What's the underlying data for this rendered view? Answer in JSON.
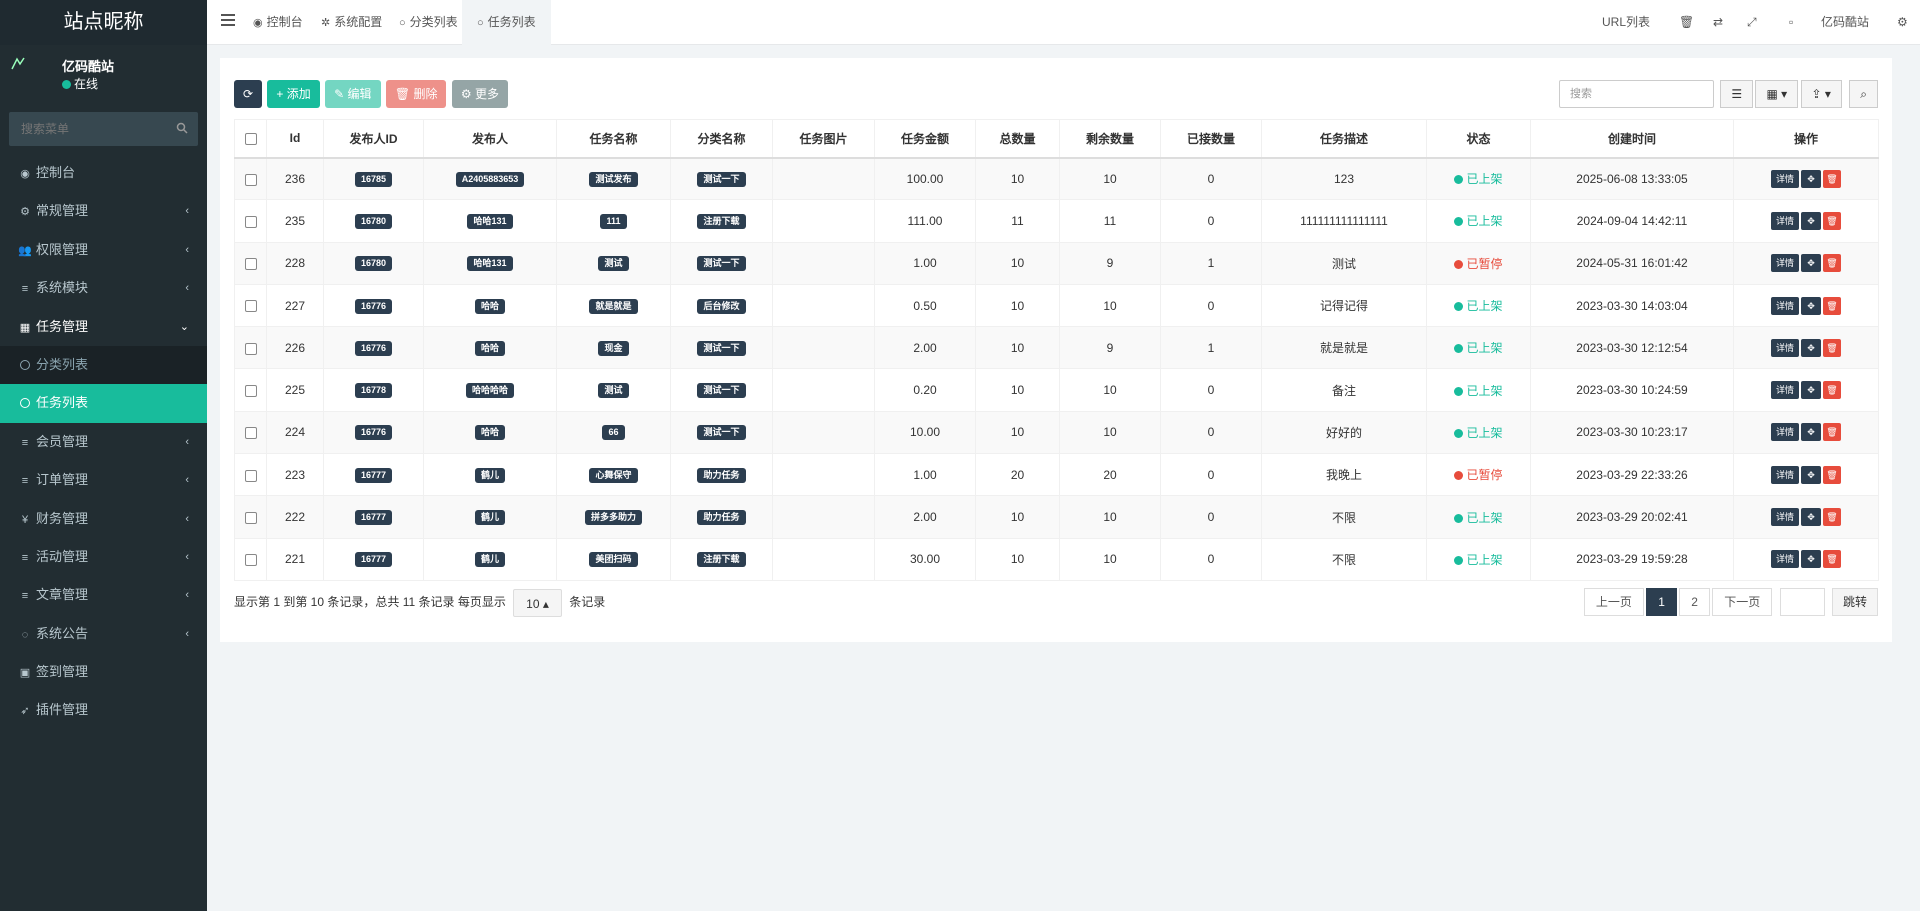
{
  "site_title": "站点昵称",
  "user": {
    "name": "亿码酷站",
    "status": "在线"
  },
  "sidebar": {
    "search_placeholder": "搜索菜单",
    "items": [
      {
        "icon": "dashboard-icon",
        "glyph": "◉",
        "label": "控制台",
        "has_arrow": false
      },
      {
        "icon": "cogs-icon",
        "glyph": "⚙",
        "label": "常规管理",
        "has_arrow": true
      },
      {
        "icon": "users-icon",
        "glyph": "👥",
        "label": "权限管理",
        "has_arrow": true
      },
      {
        "icon": "list-icon",
        "glyph": "≡",
        "label": "系统模块",
        "has_arrow": true
      },
      {
        "icon": "table-icon",
        "glyph": "▦",
        "label": "任务管理",
        "has_arrow": true,
        "open": true
      },
      {
        "icon": "circle-icon",
        "label": "分类列表",
        "sub": true
      },
      {
        "icon": "circle-icon",
        "label": "任务列表",
        "sub": true,
        "active": true
      },
      {
        "icon": "list-icon",
        "glyph": "≡",
        "label": "会员管理",
        "has_arrow": true
      },
      {
        "icon": "list-icon",
        "glyph": "≡",
        "label": "订单管理",
        "has_arrow": true
      },
      {
        "icon": "yen-icon",
        "glyph": "¥",
        "label": "财务管理",
        "has_arrow": true
      },
      {
        "icon": "list-icon",
        "glyph": "≡",
        "label": "活动管理",
        "has_arrow": true
      },
      {
        "icon": "list-icon",
        "glyph": "≡",
        "label": "文章管理",
        "has_arrow": true
      },
      {
        "icon": "comment-icon",
        "glyph": "◌",
        "label": "系统公告",
        "has_arrow": true
      },
      {
        "icon": "calendar-icon",
        "glyph": "▣",
        "label": "签到管理",
        "has_arrow": false
      },
      {
        "icon": "rocket-icon",
        "glyph": "➶",
        "label": "插件管理",
        "has_arrow": false
      }
    ]
  },
  "topnav": {
    "tabs": [
      {
        "icon": "dashboard-icon",
        "glyph": "◉",
        "label": "控制台"
      },
      {
        "icon": "gear-icon",
        "glyph": "✲",
        "label": "系统配置"
      },
      {
        "icon": "circle-icon",
        "glyph": "○",
        "label": "分类列表"
      },
      {
        "icon": "circle-icon",
        "glyph": "○",
        "label": "任务列表",
        "active": true
      }
    ],
    "url_list": "URL列表",
    "site_name": "亿码酷站"
  },
  "toolbar": {
    "add": "添加",
    "edit": "编辑",
    "delete": "删除",
    "more": "更多",
    "search_placeholder": "搜索"
  },
  "table": {
    "columns": [
      "Id",
      "发布人ID",
      "发布人",
      "任务名称",
      "分类名称",
      "任务图片",
      "任务金额",
      "总数量",
      "剩余数量",
      "已接数量",
      "任务描述",
      "状态",
      "创建时间",
      "操作"
    ],
    "rows": [
      {
        "id": "236",
        "uid": "16785",
        "user": "A2405883653",
        "name": "测试发布",
        "cat": "测试一下",
        "amount": "100.00",
        "total": "10",
        "remain": "10",
        "taken": "0",
        "desc": "123",
        "status": "已上架",
        "on": true,
        "time": "2025-06-08 13:33:05"
      },
      {
        "id": "235",
        "uid": "16780",
        "user": "哈哈131",
        "name": "111",
        "cat": "注册下载",
        "amount": "111.00",
        "total": "11",
        "remain": "11",
        "taken": "0",
        "desc": "111111111111111",
        "status": "已上架",
        "on": true,
        "time": "2024-09-04 14:42:11"
      },
      {
        "id": "228",
        "uid": "16780",
        "user": "哈哈131",
        "name": "测试",
        "cat": "测试一下",
        "amount": "1.00",
        "total": "10",
        "remain": "9",
        "taken": "1",
        "desc": "测试",
        "status": "已暂停",
        "on": false,
        "time": "2024-05-31 16:01:42"
      },
      {
        "id": "227",
        "uid": "16776",
        "user": "哈哈",
        "name": "就是就是",
        "cat": "后台修改",
        "amount": "0.50",
        "total": "10",
        "remain": "10",
        "taken": "0",
        "desc": "记得记得",
        "status": "已上架",
        "on": true,
        "time": "2023-03-30 14:03:04"
      },
      {
        "id": "226",
        "uid": "16776",
        "user": "哈哈",
        "name": "现金",
        "cat": "测试一下",
        "amount": "2.00",
        "total": "10",
        "remain": "9",
        "taken": "1",
        "desc": "就是就是",
        "status": "已上架",
        "on": true,
        "time": "2023-03-30 12:12:54"
      },
      {
        "id": "225",
        "uid": "16778",
        "user": "哈哈哈哈",
        "name": "测试",
        "cat": "测试一下",
        "amount": "0.20",
        "total": "10",
        "remain": "10",
        "taken": "0",
        "desc": "备注",
        "status": "已上架",
        "on": true,
        "time": "2023-03-30 10:24:59"
      },
      {
        "id": "224",
        "uid": "16776",
        "user": "哈哈",
        "name": "66",
        "cat": "测试一下",
        "amount": "10.00",
        "total": "10",
        "remain": "10",
        "taken": "0",
        "desc": "好好的",
        "status": "已上架",
        "on": true,
        "time": "2023-03-30 10:23:17"
      },
      {
        "id": "223",
        "uid": "16777",
        "user": "鹤儿",
        "name": "心舞保守",
        "cat": "助力任务",
        "amount": "1.00",
        "total": "20",
        "remain": "20",
        "taken": "0",
        "desc": "我晚上",
        "status": "已暂停",
        "on": false,
        "time": "2023-03-29 22:33:26"
      },
      {
        "id": "222",
        "uid": "16777",
        "user": "鹤儿",
        "name": "拼多多助力",
        "cat": "助力任务",
        "amount": "2.00",
        "total": "10",
        "remain": "10",
        "taken": "0",
        "desc": "不限",
        "status": "已上架",
        "on": true,
        "time": "2023-03-29 20:02:41"
      },
      {
        "id": "221",
        "uid": "16777",
        "user": "鹤儿",
        "name": "美团扫码",
        "cat": "注册下载",
        "amount": "30.00",
        "total": "10",
        "remain": "10",
        "taken": "0",
        "desc": "不限",
        "status": "已上架",
        "on": true,
        "time": "2023-03-29 19:59:28"
      }
    ],
    "op_detail": "详情"
  },
  "pager": {
    "info_prefix": "显示第 1 到第 10 条记录，总共 11 条记录 每页显示",
    "page_size": "10",
    "info_suffix": "条记录",
    "prev": "上一页",
    "pages": [
      "1",
      "2"
    ],
    "next": "下一页",
    "go": "跳转"
  },
  "colors": {
    "sidebar_bg": "#222d32",
    "accent": "#18bc9c",
    "dark": "#2c3e50",
    "danger": "#e74c3c"
  }
}
